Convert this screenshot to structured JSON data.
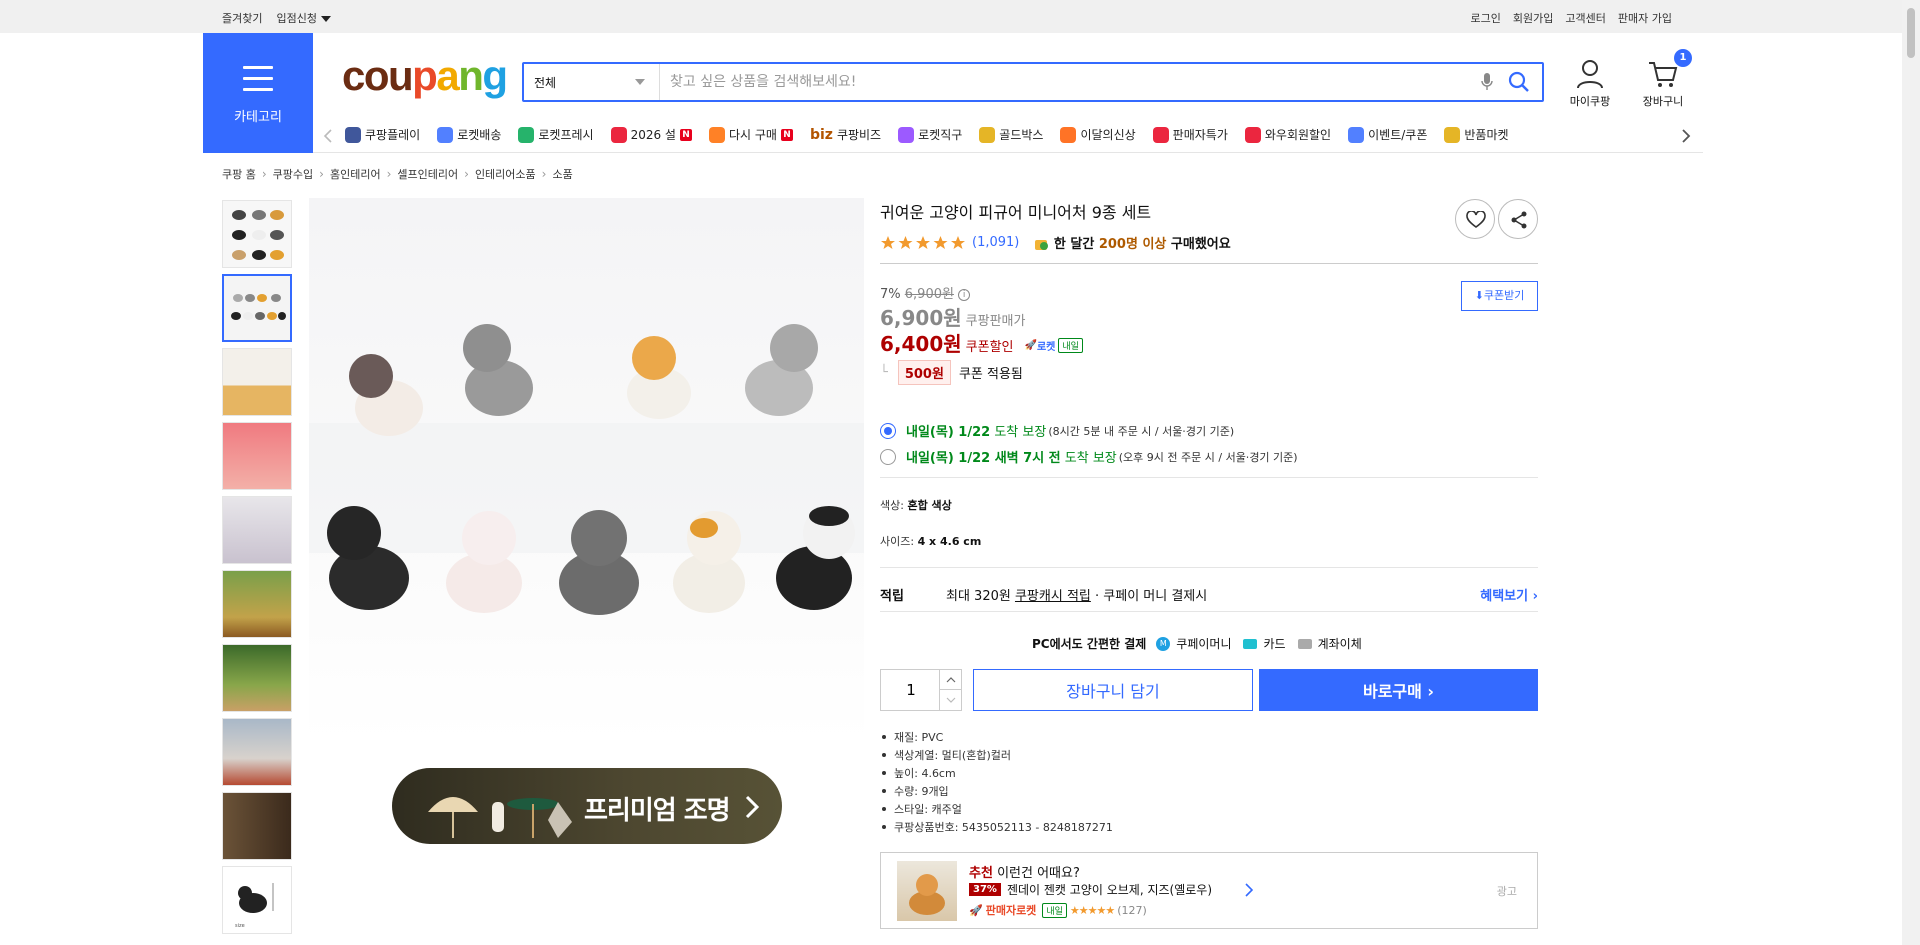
{
  "topbar": {
    "left": [
      "즐겨찾기",
      "입점신청"
    ],
    "right": [
      "로그인",
      "회원가입",
      "고객센터",
      "판매자 가입"
    ]
  },
  "header": {
    "category_label": "카테고리",
    "logo": [
      "cou",
      "p",
      "a",
      "n",
      "g"
    ],
    "search_scope": "전체",
    "search_placeholder": "찾고 싶은 상품을 검색해보세요!",
    "my_label": "마이쿠팡",
    "cart_label": "장바구니",
    "cart_count": "1"
  },
  "nav": [
    {
      "label": "쿠팡플레이",
      "icon": "play-icon",
      "color": "#1e3a8a"
    },
    {
      "label": "로켓배송",
      "icon": "rocket-icon",
      "color": "#346aff"
    },
    {
      "label": "로켓프레시",
      "icon": "rocket-fresh-icon",
      "color": "#00a651"
    },
    {
      "label": "2026 설",
      "icon": "gift-icon",
      "color": "#e8001d",
      "badge": "N"
    },
    {
      "label": "다시 구매",
      "icon": "home-icon",
      "color": "#ff6b00",
      "badge": "N"
    },
    {
      "label": "쿠팡비즈",
      "icon": "biz-icon",
      "color": "#b35400",
      "prefix": "biz"
    },
    {
      "label": "로켓직구",
      "icon": "rocket-global-icon",
      "color": "#8b3dff"
    },
    {
      "label": "골드박스",
      "icon": "goldbox-icon",
      "color": "#e0a800"
    },
    {
      "label": "이달의신상",
      "icon": "new-icon",
      "color": "#ff5a00"
    },
    {
      "label": "판매자특가",
      "icon": "percent-icon",
      "color": "#e8001d"
    },
    {
      "label": "와우회원할인",
      "icon": "wow-icon",
      "color": "#e8001d"
    },
    {
      "label": "이벤트/쿠폰",
      "icon": "coupon-icon",
      "color": "#346aff"
    },
    {
      "label": "반품마켓",
      "icon": "market-icon",
      "color": "#e0a800"
    }
  ],
  "breadcrumb": [
    "쿠팡 홈",
    "쿠팡수입",
    "홈인테리어",
    "셀프인테리어",
    "인테리어소품",
    "소품"
  ],
  "product": {
    "title": "귀여운 고양이 피규어 미니어처 9종 세트",
    "rating_count": "(1,091)",
    "bought_pre": "한 달간",
    "bought_num": "200명 이상",
    "bought_post": "구매했어요",
    "discount_pct": "7%",
    "original_price": "6,900원",
    "price": "6,900원",
    "price_sub": "쿠팡판매가",
    "coupon_price": "6,400원",
    "coupon_sub": "쿠폰할인",
    "rocket_label": "로켓",
    "rocket_tag": "내일",
    "coupon_amount": "500원",
    "coupon_applied": "쿠폰 적용됨",
    "coupon_button": "쿠폰받기",
    "delivery": [
      {
        "date": "내일(목) 1/22",
        "guarantee": "도착 보장",
        "note": "(8시간 5분 내 주문 시 / 서울⋅경기 기준)",
        "selected": true
      },
      {
        "date": "내일(목) 1/22 새벽 7시 전",
        "guarantee": "도착 보장",
        "note": "(오후 9시 전 주문 시 / 서울⋅경기 기준)",
        "selected": false
      }
    ],
    "color_label": "색상:",
    "color_value": "혼합 색상",
    "size_label": "사이즈:",
    "size_value": "4 x 4.6 cm",
    "reward_key": "적립",
    "reward_pre": "최대 320원",
    "reward_link": "쿠팡캐시 적립",
    "reward_post": "· 쿠페이 머니 결제시",
    "reward_more": "혜택보기",
    "pay_head": "PC에서도 간편한 결제",
    "pay_opts": [
      "쿠페이머니",
      "카드",
      "계좌이체"
    ],
    "qty": "1",
    "cart_btn": "장바구니 담기",
    "buy_btn": "바로구매",
    "specs": [
      "재질: PVC",
      "색상계열: 멀티(혼합)컬러",
      "높이: 4.6cm",
      "수량: 9개입",
      "스타일: 캐주얼",
      "쿠팡상품번호: 5435052113 - 8248187271"
    ]
  },
  "premium_banner": "프리미엄 조명",
  "reco": {
    "label_red": "추천",
    "label": "이런건 어때요?",
    "discount": "37%",
    "name": "젠데이 젠캣 고양이 오브제, 지즈(옐로우)",
    "seller": "판매자로켓",
    "tag": "내일",
    "count": "(127)",
    "ad": "광고"
  },
  "colors": {
    "accent": "#346aff",
    "price_red": "#ae0000",
    "green": "#00891a"
  }
}
